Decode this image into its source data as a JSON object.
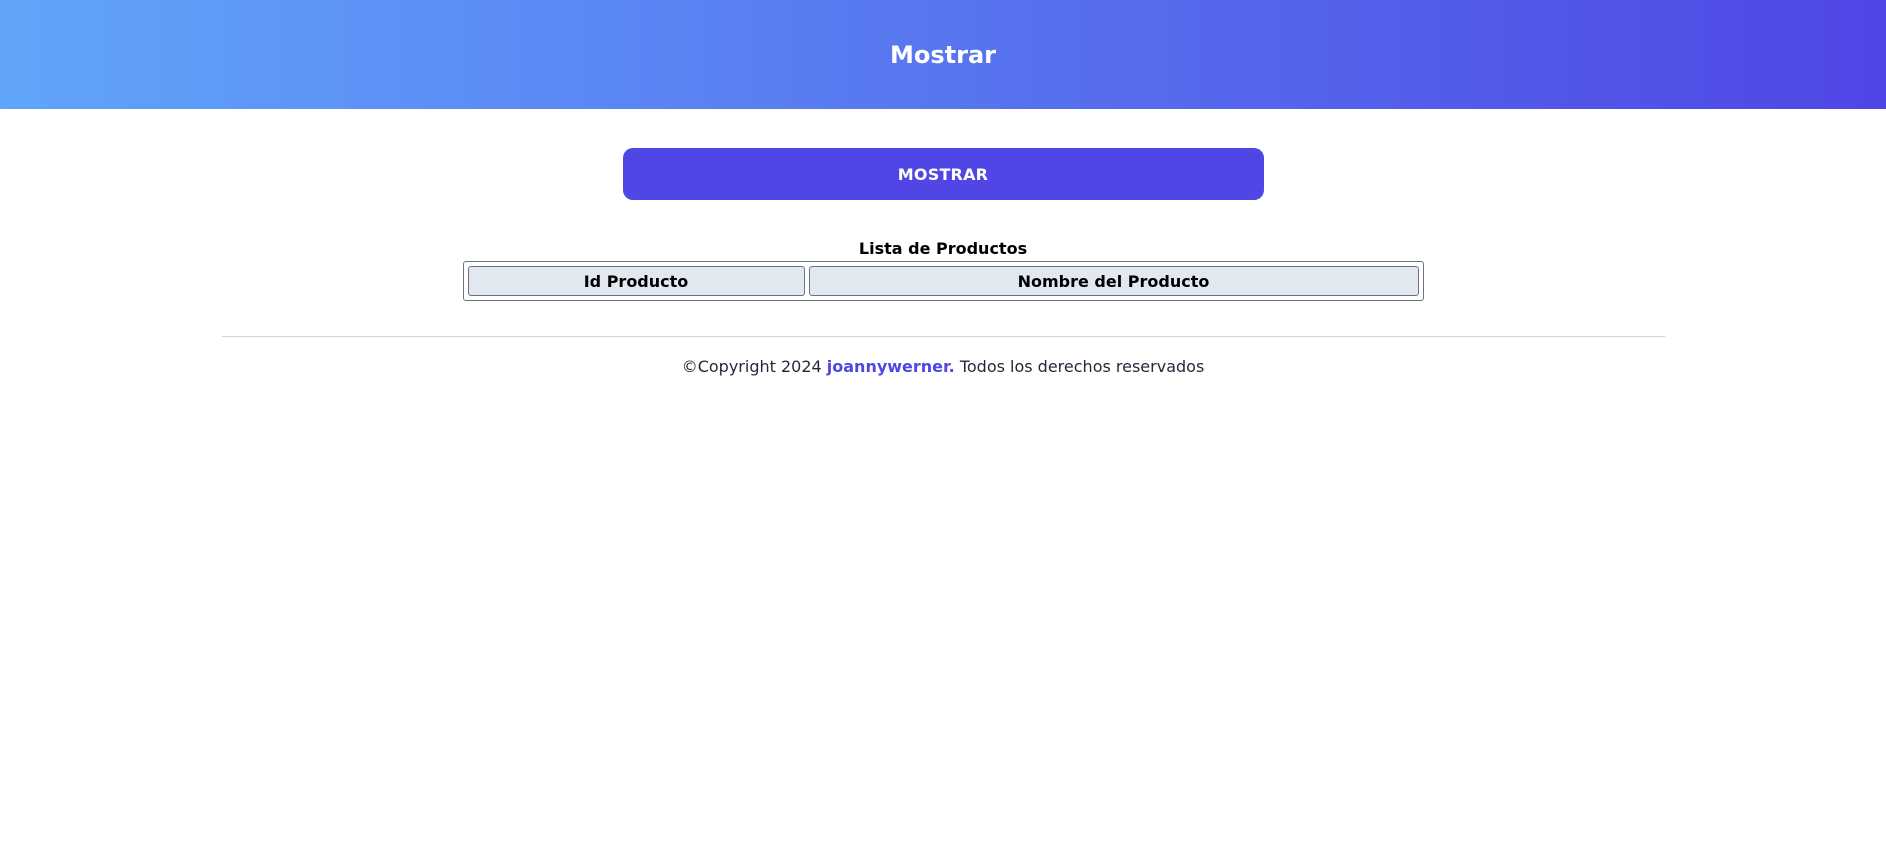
{
  "header": {
    "title": "Mostrar"
  },
  "actions": {
    "show_button_label": "MOSTRAR"
  },
  "table": {
    "caption": "Lista de Productos",
    "columns": [
      "Id Producto",
      "Nombre del Producto"
    ],
    "rows": []
  },
  "footer": {
    "prefix": "©Copyright 2024",
    "author": "joannywerner.",
    "suffix": "Todos los derechos reservados"
  },
  "colors": {
    "header_gradient_start": "#60a5fa",
    "header_gradient_end": "#4f46e5",
    "accent": "#4f46e5",
    "table_header_bg": "#e2e8f0"
  }
}
